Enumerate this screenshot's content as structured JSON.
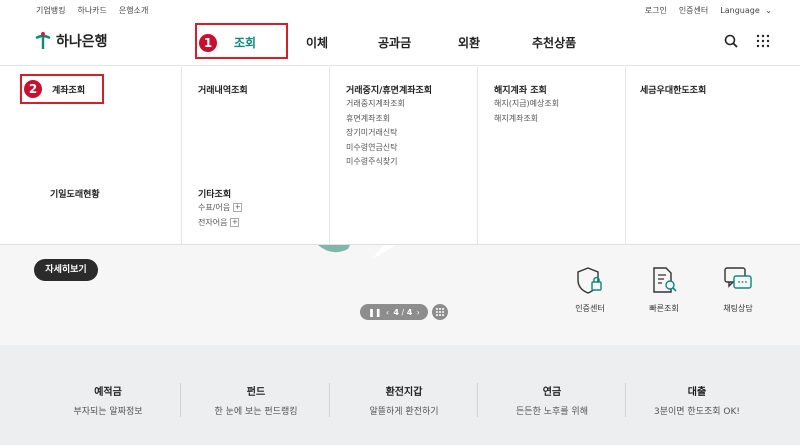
{
  "utility": {
    "left": [
      "기업뱅킹",
      "하나카드",
      "은행소개"
    ],
    "login": "로그인",
    "cert": "인증센터",
    "language": "Language"
  },
  "logo": {
    "text": "하나은행"
  },
  "gnb": [
    {
      "label": "조회",
      "active": true
    },
    {
      "label": "이체",
      "active": false
    },
    {
      "label": "공과금",
      "active": false
    },
    {
      "label": "외환",
      "active": false
    },
    {
      "label": "추천상품",
      "active": false
    }
  ],
  "annotations": {
    "badge1": "1",
    "badge2": "2"
  },
  "mega": {
    "col1": {
      "title": "계좌조회",
      "title2": "기일도래현황"
    },
    "col2": {
      "title": "거래내역조회",
      "title2": "기타조회",
      "subs2": [
        "수표/어음",
        "전자어음"
      ]
    },
    "col3": {
      "title": "거래중지/휴면계좌조회",
      "subs": [
        "거래중지계좌조회",
        "휴면계좌조회",
        "장기미거래신탁",
        "미수령연금신탁",
        "미수령주식찾기"
      ]
    },
    "col4": {
      "title": "해지계좌 조회",
      "subs": [
        "해지(지급)예상조회",
        "해지계좌조회"
      ]
    },
    "col5": {
      "title": "세금우대한도조회"
    }
  },
  "hero": {
    "detail_button": "자세히보기",
    "pager": {
      "current": "4",
      "total": "4"
    }
  },
  "quick_links": [
    {
      "label": "인증센터",
      "icon": "shield-lock-icon"
    },
    {
      "label": "빠른조회",
      "icon": "document-search-icon"
    },
    {
      "label": "채팅상담",
      "icon": "chat-icon"
    }
  ],
  "bottom": [
    {
      "title": "예적금",
      "sub": "부자되는 알짜정보"
    },
    {
      "title": "펀드",
      "sub": "한 눈에 보는 펀드랭킹"
    },
    {
      "title": "환전지갑",
      "sub": "알뜰하게 환전하기"
    },
    {
      "title": "연금",
      "sub": "든든한 노후를 위해"
    },
    {
      "title": "대출",
      "sub": "3분이면 한도조회 OK!"
    }
  ],
  "colors": {
    "brand": "#0b8a7e",
    "annotation_red": "#d51f2a"
  }
}
